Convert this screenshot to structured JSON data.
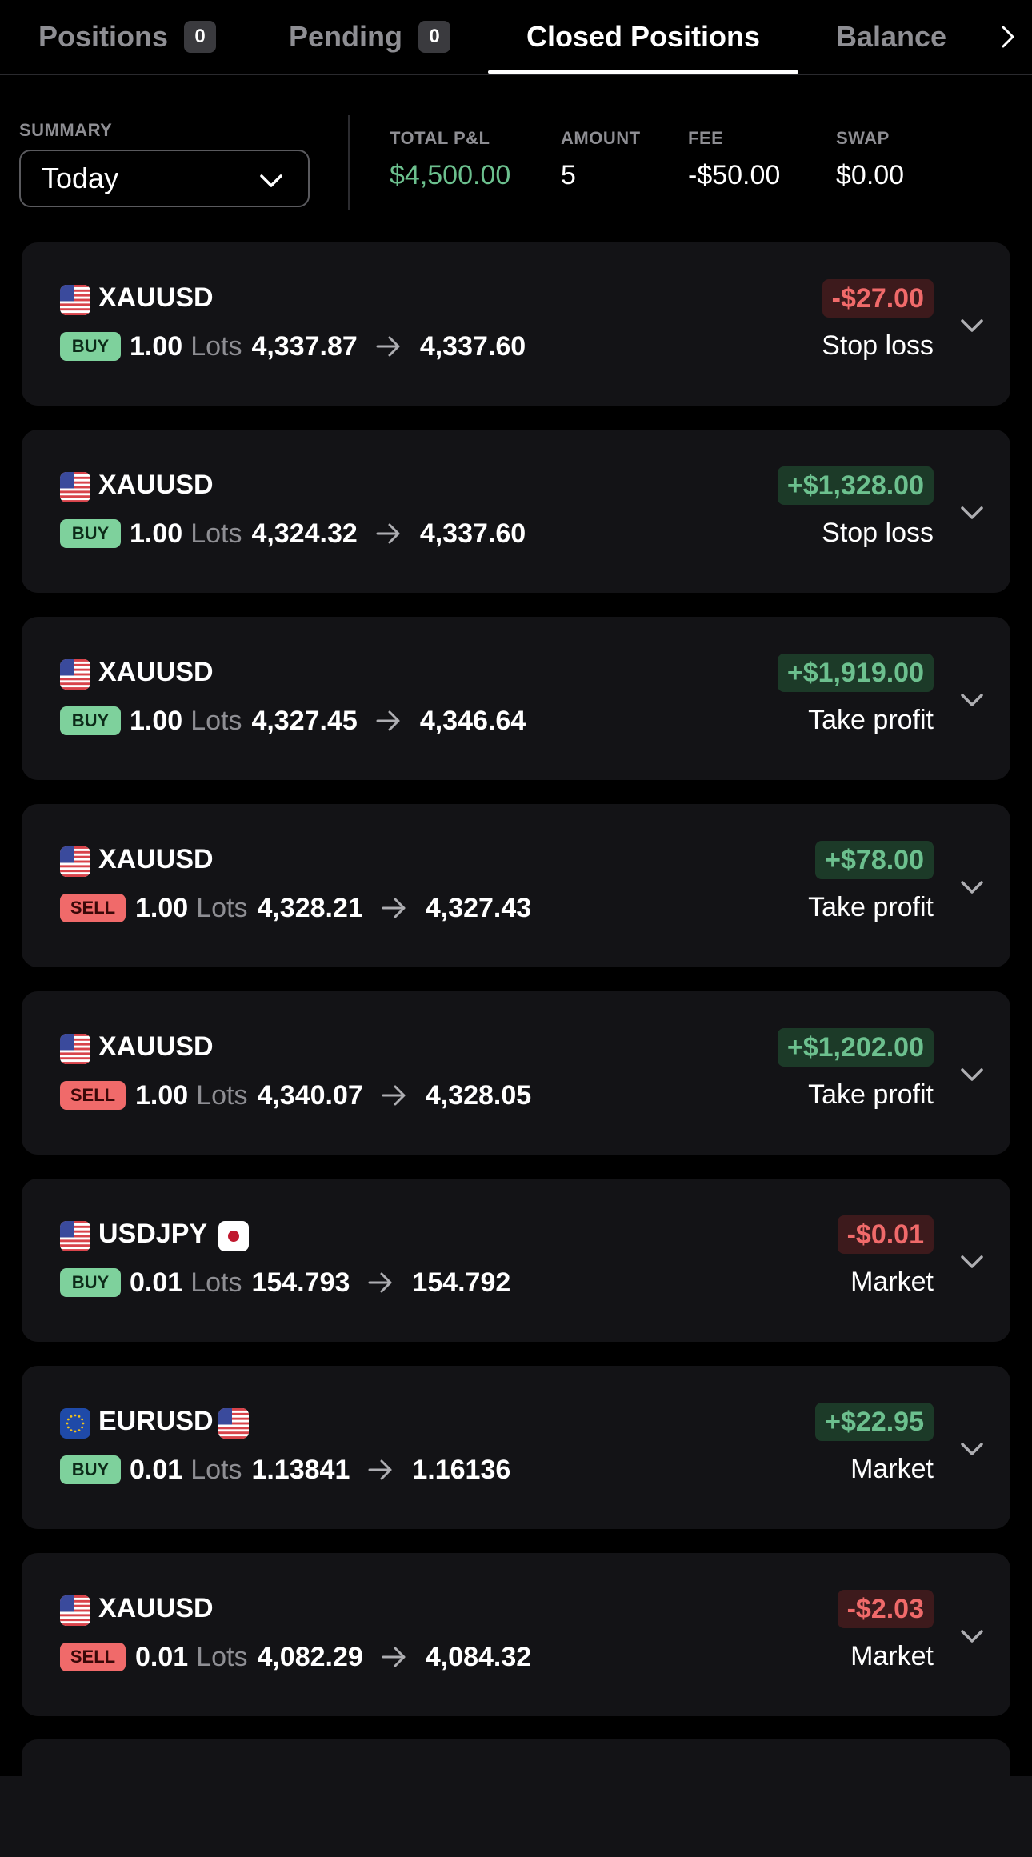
{
  "tabs": [
    {
      "label": "Positions",
      "count": "0"
    },
    {
      "label": "Pending",
      "count": "0"
    },
    {
      "label": "Closed Positions"
    },
    {
      "label": "Balance"
    }
  ],
  "active_tab": "Closed Positions",
  "summary": {
    "label": "SUMMARY",
    "period": "Today",
    "total_pnl_label": "TOTAL P&L",
    "total_pnl": "$4,500.00",
    "amount_label": "AMOUNT",
    "amount": "5",
    "fee_label": "FEE",
    "fee": "-$50.00",
    "swap_label": "SWAP",
    "swap": "$0.00"
  },
  "positions": [
    {
      "symbol": "XAUUSD",
      "flag": "us",
      "side": "BUY",
      "volume": "1.00",
      "lots_label": "Lots",
      "open": "4,337.87",
      "close": "4,337.60",
      "pnl": "-$27.00",
      "pnl_sign": "negative",
      "reason": "Stop loss"
    },
    {
      "symbol": "XAUUSD",
      "flag": "us",
      "side": "BUY",
      "volume": "1.00",
      "lots_label": "Lots",
      "open": "4,324.32",
      "close": "4,337.60",
      "pnl": "+$1,328.00",
      "pnl_sign": "positive",
      "reason": "Stop loss"
    },
    {
      "symbol": "XAUUSD",
      "flag": "us",
      "side": "BUY",
      "volume": "1.00",
      "lots_label": "Lots",
      "open": "4,327.45",
      "close": "4,346.64",
      "pnl": "+$1,919.00",
      "pnl_sign": "positive",
      "reason": "Take profit"
    },
    {
      "symbol": "XAUUSD",
      "flag": "us",
      "side": "SELL",
      "volume": "1.00",
      "lots_label": "Lots",
      "open": "4,328.21",
      "close": "4,327.43",
      "pnl": "+$78.00",
      "pnl_sign": "positive",
      "reason": "Take profit"
    },
    {
      "symbol": "XAUUSD",
      "flag": "us",
      "side": "SELL",
      "volume": "1.00",
      "lots_label": "Lots",
      "open": "4,340.07",
      "close": "4,328.05",
      "pnl": "+$1,202.00",
      "pnl_sign": "positive",
      "reason": "Take profit"
    },
    {
      "symbol": "USDJPY",
      "flag": "us",
      "flag2": "jp",
      "side": "BUY",
      "volume": "0.01",
      "lots_label": "Lots",
      "open": "154.793",
      "close": "154.792",
      "pnl": "-$0.01",
      "pnl_sign": "negative",
      "reason": "Market"
    },
    {
      "symbol": "EURUSD",
      "flag": "eu",
      "flag2": "us",
      "side": "BUY",
      "volume": "0.01",
      "lots_label": "Lots",
      "open": "1.13841",
      "close": "1.16136",
      "pnl": "+$22.95",
      "pnl_sign": "positive",
      "reason": "Market"
    },
    {
      "symbol": "XAUUSD",
      "flag": "us",
      "side": "SELL",
      "volume": "0.01",
      "lots_label": "Lots",
      "open": "4,082.29",
      "close": "4,084.32",
      "pnl": "-$2.03",
      "pnl_sign": "negative",
      "reason": "Market"
    }
  ],
  "colors": {
    "positive": "#6cc08e",
    "negative": "#f06a6a",
    "buy_badge": "#7ed19c",
    "sell_badge": "#f06a6a",
    "card_bg": "#131316"
  }
}
